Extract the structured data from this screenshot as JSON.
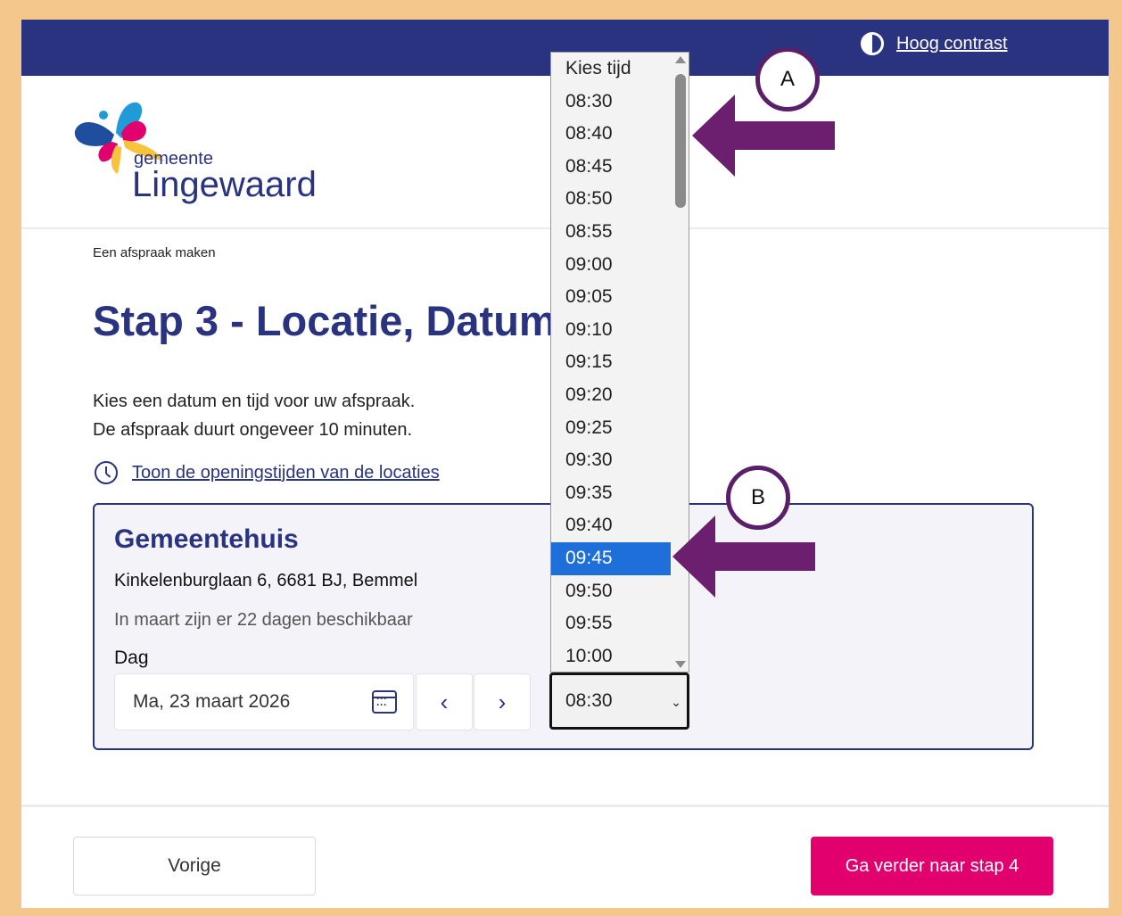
{
  "topbar": {
    "contrast_label": "Hoog contrast"
  },
  "logo": {
    "small": "gemeente",
    "big": "Lingewaard"
  },
  "breadcrumb": "Een afspraak maken",
  "page_title": "Stap 3 - Locatie, Datum en tijd",
  "intro": {
    "line1": "Kies een datum en tijd voor uw afspraak.",
    "line2": "De afspraak duurt ongeveer 10 minuten."
  },
  "hours_link": "Toon de openingstijden van de locaties",
  "location": {
    "name": "Gemeentehuis",
    "address": "Kinkelenburglaan 6, 6681 BJ, Bemmel",
    "availability": "In maart zijn er 22 dagen beschikbaar",
    "day_label": "Dag",
    "date_value": "Ma, 23 maart 2026",
    "prev_day": "‹",
    "next_day": "›"
  },
  "time_select": {
    "value": "08:30",
    "options": [
      "Kies tijd",
      "08:30",
      "08:40",
      "08:45",
      "08:50",
      "08:55",
      "09:00",
      "09:05",
      "09:10",
      "09:15",
      "09:20",
      "09:25",
      "09:30",
      "09:35",
      "09:40",
      "09:45",
      "09:50",
      "09:55",
      "10:00"
    ],
    "highlighted": "09:45"
  },
  "annotations": {
    "a": "A",
    "b": "B",
    "arrow_color": "#6b1f6e"
  },
  "footer": {
    "prev_label": "Vorige",
    "next_label": "Ga verder naar stap 4"
  },
  "colors": {
    "brand_blue": "#29337f",
    "accent_pink": "#e2006f",
    "highlight": "#1e6fd9",
    "frame": "#f4c88c"
  }
}
